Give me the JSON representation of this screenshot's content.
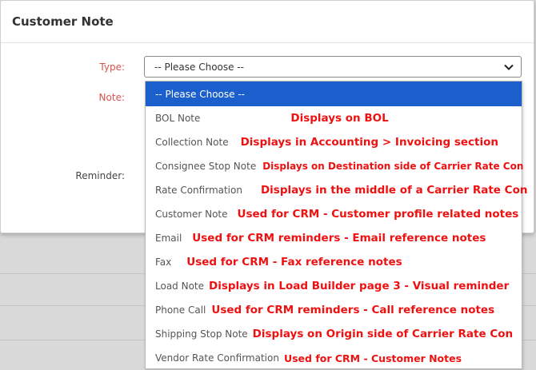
{
  "modal": {
    "title": "Customer Note",
    "labels": {
      "type": "Type:",
      "note": "Note:",
      "reminder": "Reminder:"
    }
  },
  "type_select": {
    "value": "-- Please Choose --"
  },
  "options": [
    {
      "label": "-- Please Choose --",
      "note": ""
    },
    {
      "label": "BOL Note",
      "note": "Displays on BOL"
    },
    {
      "label": "Collection Note",
      "note": "Displays in Accounting > Invoicing section"
    },
    {
      "label": "Consignee Stop Note",
      "note": "Displays on Destination side of Carrier Rate Con"
    },
    {
      "label": "Rate Confirmation",
      "note": "Displays in the middle of a Carrier Rate Con"
    },
    {
      "label": "Customer Note",
      "note": "Used for CRM - Customer profile related notes"
    },
    {
      "label": "Email",
      "note": "Used for CRM reminders - Email reference notes"
    },
    {
      "label": "Fax",
      "note": "Used for CRM - Fax reference notes"
    },
    {
      "label": "Load Note",
      "note": "Displays in Load Builder page 3 - Visual reminder"
    },
    {
      "label": "Phone Call",
      "note": "Used for CRM reminders - Call reference notes"
    },
    {
      "label": "Shipping Stop Note",
      "note": "Displays on Origin side of Carrier Rate Con"
    },
    {
      "label": "Vendor Rate Confirmation",
      "note": "Used for CRM - Customer Notes"
    }
  ],
  "colors": {
    "selected_bg": "#1b5fcc",
    "annotation": "#ee1111"
  }
}
